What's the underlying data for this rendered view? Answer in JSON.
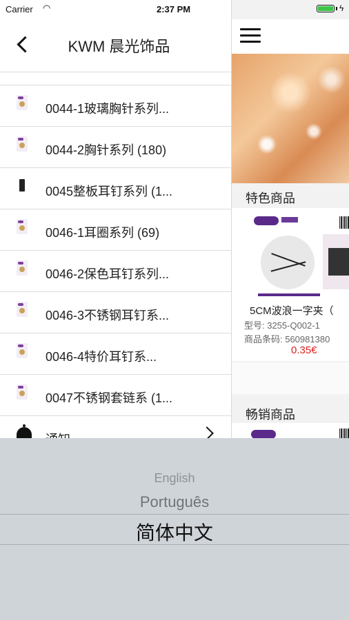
{
  "status_bar": {
    "carrier": "Carrier",
    "time": "2:37 PM"
  },
  "drawer": {
    "title": "KWM 晨光饰品",
    "categories": [
      {
        "label": "0044-1玻璃胸针系列...",
        "thumb": "light"
      },
      {
        "label": "0044-2胸针系列 (180)",
        "thumb": "light"
      },
      {
        "label": "0045整板耳钉系列 (1...",
        "thumb": "dark"
      },
      {
        "label": "0046-1耳圈系列 (69)",
        "thumb": "light"
      },
      {
        "label": "0046-2保色耳钉系列...",
        "thumb": "light"
      },
      {
        "label": "0046-3不锈钢耳钉系...",
        "thumb": "light"
      },
      {
        "label": "0046-4特价耳钉系...",
        "thumb": "light"
      },
      {
        "label": "0047不锈钢套链系 (1...",
        "thumb": "light"
      }
    ],
    "notice_label": "通知"
  },
  "main": {
    "featured_title": "特色商品",
    "featured_product": {
      "name": "5CM波浪一字夹（",
      "model": "型号: 3255-Q002-1",
      "barcode": "商品条码: 560981380",
      "price": "0.35€"
    },
    "bestseller_title": "畅销商品"
  },
  "language_picker": {
    "options": [
      "English",
      "Português",
      "简体中文"
    ],
    "selected": "简体中文"
  },
  "colors": {
    "price": "#e01e1e",
    "brand": "#5a2a8a",
    "picker_bg": "#cfd4d9"
  }
}
